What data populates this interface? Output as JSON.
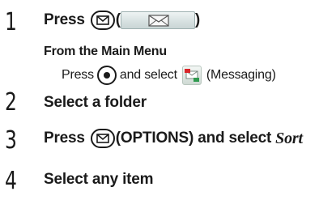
{
  "steps": [
    {
      "number": "1",
      "text_before": "Press",
      "text_open_paren": "(",
      "text_close_paren": ")"
    },
    {
      "number": "2",
      "text": "Select a folder"
    },
    {
      "number": "3",
      "text_before": "Press",
      "text_after": "(OPTIONS) and select",
      "italic": "Sort"
    },
    {
      "number": "4",
      "text": "Select any item"
    }
  ],
  "note": {
    "heading": "From the Main Menu",
    "text_before": "Press",
    "text_middle": "and select",
    "text_after": "(Messaging)"
  },
  "icons": {
    "mail_key": "mail-key-icon",
    "envelope_softkey": "envelope-icon",
    "center_key": "center-select-key-icon",
    "messaging": "messaging-app-icon"
  },
  "colors": {
    "text": "#1a1a1a",
    "softkey_fill": "#d8e2e2",
    "messaging_icon_red": "#d9262b",
    "messaging_icon_green": "#2f9a4f"
  }
}
